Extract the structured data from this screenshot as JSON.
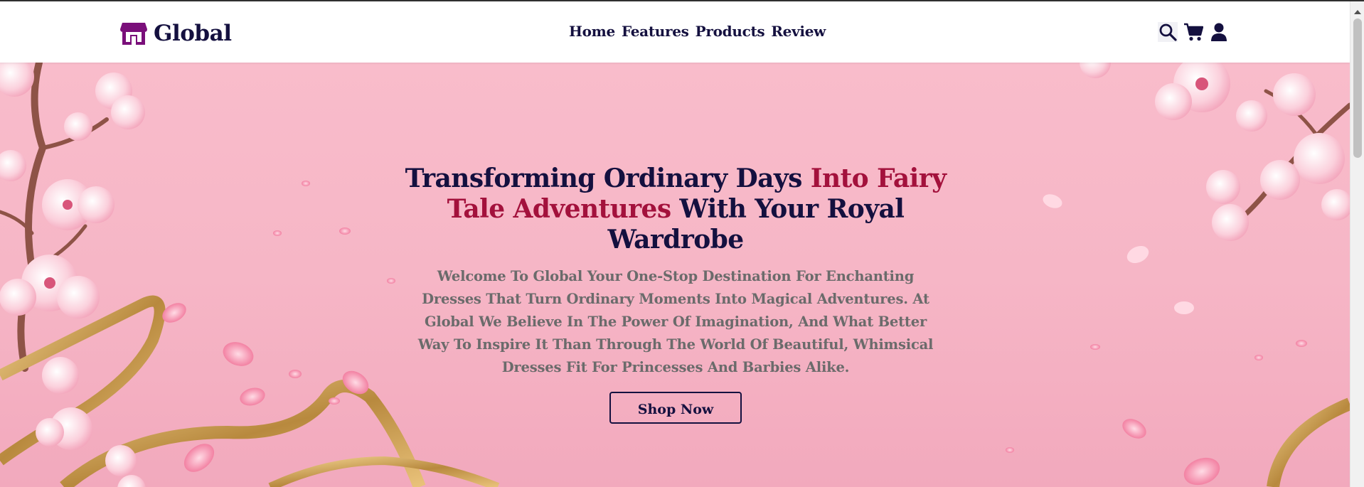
{
  "brand": {
    "name": "Global",
    "icon": "store-icon",
    "color": "#14103f",
    "icon_color": "#7a0f7a"
  },
  "nav": {
    "items": [
      {
        "label": "Home"
      },
      {
        "label": "Features"
      },
      {
        "label": "Products"
      },
      {
        "label": "Review"
      }
    ]
  },
  "header_icons": [
    "search-icon",
    "cart-icon",
    "user-icon"
  ],
  "hero": {
    "headline": {
      "part1": "Transforming Ordinary Days ",
      "accent": "Into Fairy Tale Adventures",
      "part2": " With Your Royal Wardrobe"
    },
    "subtext": "Welcome To Global Your One-Stop Destination For Enchanting Dresses That Turn Ordinary Moments Into Magical Adventures. At Global We Believe In The Power Of Imagination, And What Better Way To Inspire It Than Through The World Of Beautiful, Whimsical Dresses Fit For Princesses And Barbies Alike.",
    "cta_label": "Shop Now"
  },
  "colors": {
    "navy": "#14103f",
    "accent": "#a3113c",
    "body_text": "#6b6b6b",
    "hero_bg": "#f7b8c8"
  }
}
